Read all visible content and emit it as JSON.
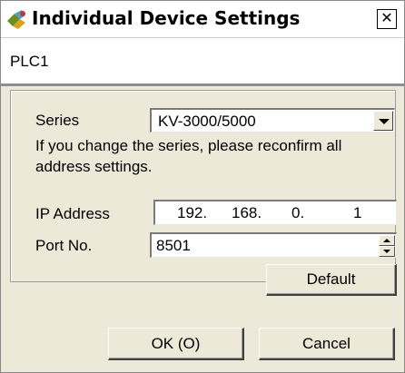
{
  "window": {
    "title": "Individual Device Settings",
    "close_glyph": "✕",
    "icon": "device-settings-icon"
  },
  "header": {
    "device_name": "PLC1"
  },
  "form": {
    "series_label": "Series",
    "series_value": "KV-3000/5000",
    "notice_line1": "If you change the series, please reconfirm all",
    "notice_line2": "address settings.",
    "ip_label": "IP Address",
    "ip_octets": [
      "192.",
      "168.",
      "0.",
      "1"
    ],
    "port_label": "Port No.",
    "port_value": "8501"
  },
  "buttons": {
    "default": "Default",
    "ok": "OK (O)",
    "cancel": "Cancel"
  }
}
